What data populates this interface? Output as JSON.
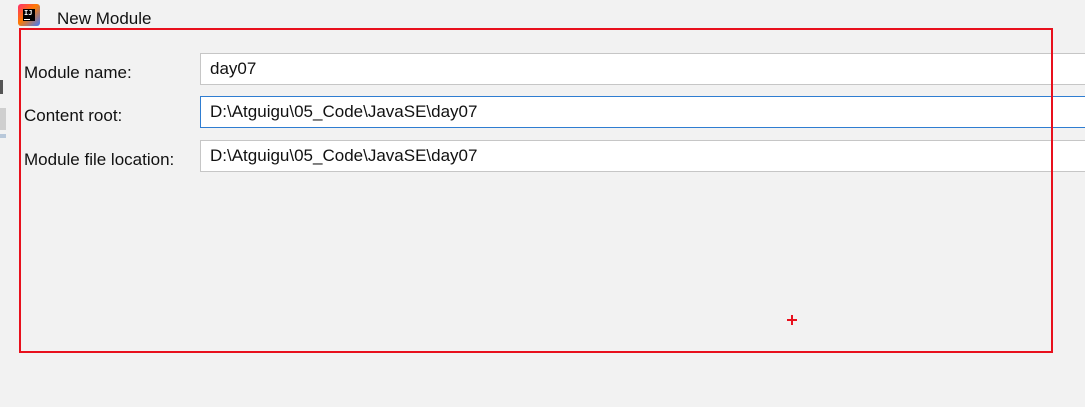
{
  "window": {
    "title": "New Module",
    "app_icon_text": "IJ"
  },
  "form": {
    "module_name": {
      "label": "Module name:",
      "value": "day07"
    },
    "content_root": {
      "label": "Content root:",
      "value": "D:\\Atguigu\\05_Code\\JavaSE\\day07"
    },
    "module_file_location": {
      "label": "Module file location:",
      "value": "D:\\Atguigu\\05_Code\\JavaSE\\day07"
    }
  },
  "colors": {
    "background": "#f2f2f2",
    "field_border": "#c6c6c6",
    "focus_border": "#2f7dd1",
    "annotation": "#e8101d"
  },
  "icons": {
    "app": "intellij-idea-icon",
    "pointer": "crosshair-plus-icon"
  }
}
